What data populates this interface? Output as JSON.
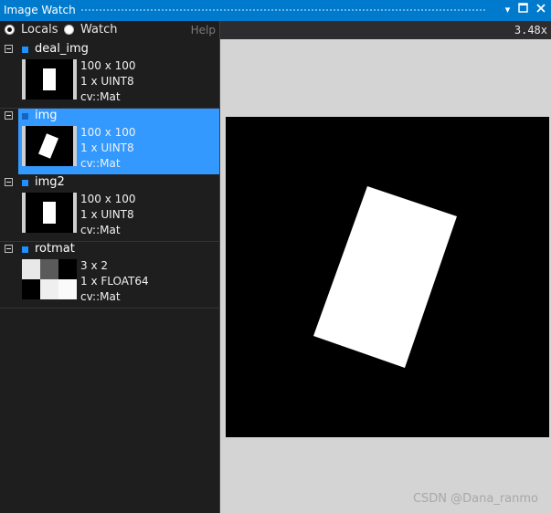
{
  "window": {
    "title": "Image Watch"
  },
  "toolbar": {
    "locals_label": "Locals",
    "watch_label": "Watch",
    "help_label": "Help",
    "selected_scope": "Locals"
  },
  "viewer": {
    "zoom": "3.48x"
  },
  "items": [
    {
      "name": "deal_img",
      "info": [
        "100 x 100",
        "1 x UINT8",
        "cv::Mat"
      ]
    },
    {
      "name": "img",
      "info": [
        "100 x 100",
        "1 x UINT8",
        "cv::Mat"
      ]
    },
    {
      "name": "img2",
      "info": [
        "100 x 100",
        "1 x UINT8",
        "cv::Mat"
      ]
    },
    {
      "name": "rotmat",
      "info": [
        "3 x 2",
        "1 x FLOAT64",
        "cv::Mat"
      ]
    }
  ],
  "watermark": "CSDN @Dana_ranmo",
  "colors": {
    "accent": "#007acc",
    "selection": "#3399ff",
    "panel": "#1e1e1e",
    "viewer_bg": "#d4d4d4"
  }
}
